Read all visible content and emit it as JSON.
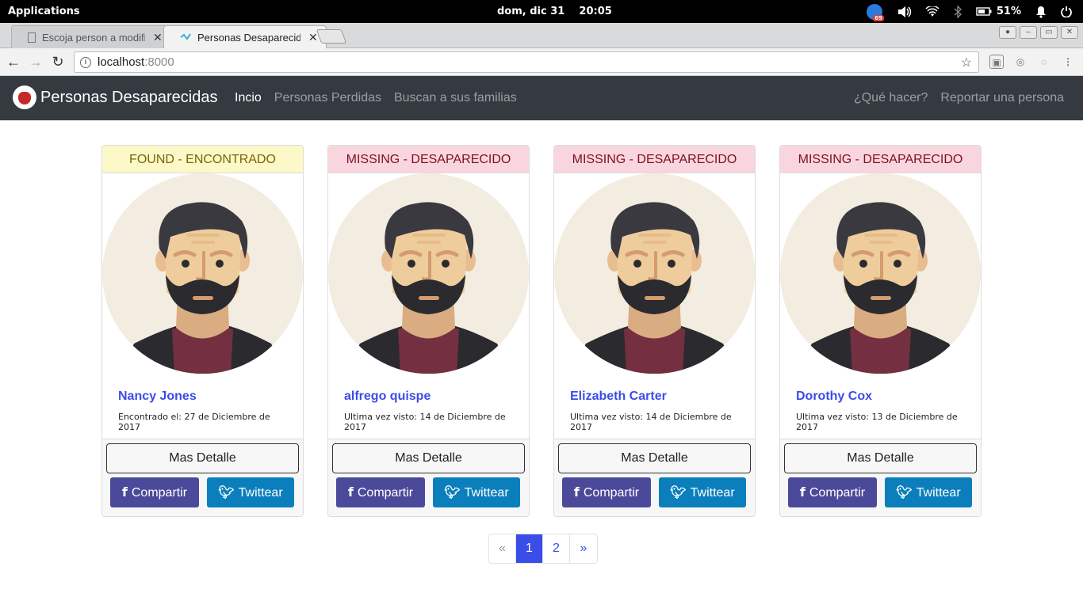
{
  "os": {
    "apps_label": "Applications",
    "clock": "dom, dic 31    20:05",
    "badge_count": "69",
    "battery": "51%"
  },
  "browser": {
    "tabs": [
      {
        "title": "Escoja person a modific",
        "active": false
      },
      {
        "title": "Personas Desaparecida",
        "active": true
      }
    ],
    "url_host": "localhost",
    "url_port": ":8000"
  },
  "site": {
    "brand": "Personas Desaparecidas",
    "nav": [
      {
        "label": "Incio",
        "active": true
      },
      {
        "label": "Personas Perdidas",
        "active": false
      },
      {
        "label": "Buscan a sus familias",
        "active": false
      }
    ],
    "nav_right": [
      {
        "label": "¿Qué hacer?"
      },
      {
        "label": "Reportar una persona"
      }
    ]
  },
  "cards": [
    {
      "status": "FOUND - ENCONTRADO",
      "status_type": "found",
      "name": "Nancy Jones",
      "date": "Encontrado el: 27 de Diciembre de 2017"
    },
    {
      "status": "MISSING - DESAPARECIDO",
      "status_type": "missing",
      "name": "alfrego quispe",
      "date": "Ultima vez visto: 14 de Diciembre de 2017"
    },
    {
      "status": "MISSING - DESAPARECIDO",
      "status_type": "missing",
      "name": "Elizabeth Carter",
      "date": "Ultima vez visto: 14 de Diciembre de 2017"
    },
    {
      "status": "MISSING - DESAPARECIDO",
      "status_type": "missing",
      "name": "Dorothy Cox",
      "date": "Ultima vez visto: 13 de Diciembre de 2017"
    }
  ],
  "card_buttons": {
    "detail": "Mas Detalle",
    "share": "Compartir",
    "tweet": "Twittear"
  },
  "pagination": {
    "prev": "«",
    "pages": [
      "1",
      "2"
    ],
    "current": "1",
    "next": "»"
  },
  "colors": {
    "accent": "#3b4de8",
    "navbar": "#343a40",
    "facebook": "#4b4a9a",
    "twitter": "#0a7fbc",
    "found_bg": "#fcf8c8",
    "missing_bg": "#f9d6dd"
  }
}
